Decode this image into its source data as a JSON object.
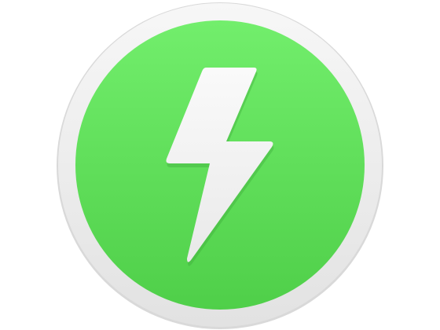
{
  "icon": {
    "name": "lightning-bolt-app-icon",
    "colors": {
      "background": "#ffffff",
      "outer_ring": "#eeeeee",
      "outer_ring_shadow": "#d4d4d4",
      "green_top": "#72ee6c",
      "green_bottom": "#4fcf49",
      "bolt": "#f3f3f3",
      "bolt_shadow": "#3aa337"
    }
  }
}
